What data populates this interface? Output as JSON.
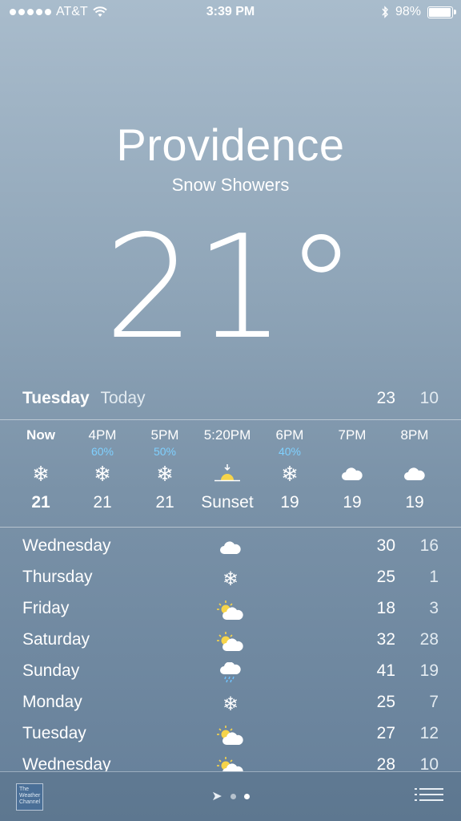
{
  "status": {
    "carrier": "AT&T",
    "time": "3:39 PM",
    "battery": "98%"
  },
  "main": {
    "city": "Providence",
    "condition": "Snow Showers",
    "temperature": "21°"
  },
  "today": {
    "day": "Tuesday",
    "label": "Today",
    "high": "23",
    "low": "10"
  },
  "hourly": [
    {
      "time": "Now",
      "chance": "",
      "icon": "snowflake-icon",
      "value": "21"
    },
    {
      "time": "4PM",
      "chance": "60%",
      "icon": "snowflake-icon",
      "value": "21"
    },
    {
      "time": "5PM",
      "chance": "50%",
      "icon": "snowflake-icon",
      "value": "21"
    },
    {
      "time": "5:20PM",
      "chance": "",
      "icon": "sunset-icon",
      "value": "Sunset"
    },
    {
      "time": "6PM",
      "chance": "40%",
      "icon": "snowflake-icon",
      "value": "19"
    },
    {
      "time": "7PM",
      "chance": "",
      "icon": "cloud-icon",
      "value": "19"
    },
    {
      "time": "8PM",
      "chance": "",
      "icon": "cloud-icon",
      "value": "19"
    }
  ],
  "daily": [
    {
      "day": "Wednesday",
      "icon": "cloud-icon",
      "high": "30",
      "low": "16"
    },
    {
      "day": "Thursday",
      "icon": "snowflake-icon",
      "high": "25",
      "low": "1"
    },
    {
      "day": "Friday",
      "icon": "partly-sunny-icon",
      "high": "18",
      "low": "3"
    },
    {
      "day": "Saturday",
      "icon": "partly-sunny-icon",
      "high": "32",
      "low": "28"
    },
    {
      "day": "Sunday",
      "icon": "rain-cloud-icon",
      "high": "41",
      "low": "19"
    },
    {
      "day": "Monday",
      "icon": "snowflake-icon",
      "high": "25",
      "low": "7"
    },
    {
      "day": "Tuesday",
      "icon": "partly-sunny-icon",
      "high": "27",
      "low": "12"
    },
    {
      "day": "Wednesday",
      "icon": "partly-sunny-icon",
      "high": "28",
      "low": "10"
    }
  ],
  "footer": {
    "logo_text": "The Weather Channel"
  },
  "colors": {
    "precip": "#7fd0ff"
  }
}
